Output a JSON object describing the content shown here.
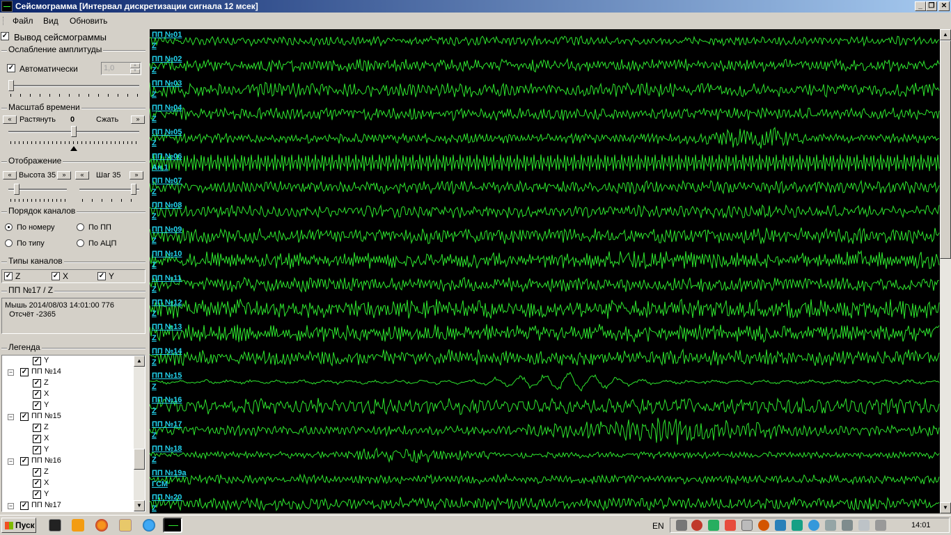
{
  "window": {
    "title": "Сейсмограмма [Интервал дискретизации сигнала 12 мсек]",
    "min_symbol": "_",
    "max_symbol": "❐",
    "close_symbol": "✕"
  },
  "menu": [
    "Файл",
    "Вид",
    "Обновить"
  ],
  "sidebar": {
    "show_seismogram": {
      "label": "Вывод сейсмограммы",
      "checked": true
    },
    "amplitude": {
      "title": "Ослабление амплитуды",
      "auto_label": "Автоматически",
      "auto_checked": true,
      "value": "1,0",
      "slider_level": 0.0
    },
    "time_scale": {
      "title": "Масштаб времени",
      "stretch_label": "Растянуть",
      "value": "0",
      "compress_label": "Сжать",
      "left_btn": "«",
      "right_btn": "»",
      "slider_level": 0.5
    },
    "display": {
      "title": "Отображение",
      "height_label": "Высота 35",
      "step_label": "Шаг 35",
      "left_btn": "«",
      "right_btn": "»",
      "height_level": 0.1,
      "step_level": 0.95
    },
    "channel_order": {
      "title": "Порядок каналов",
      "options": [
        {
          "label": "По номеру",
          "selected": true
        },
        {
          "label": "По ПП",
          "selected": false
        },
        {
          "label": "По типу",
          "selected": false
        },
        {
          "label": "По АЦП",
          "selected": false
        }
      ]
    },
    "channel_types": {
      "title": "Типы каналов",
      "items": [
        {
          "label": "Z",
          "checked": true
        },
        {
          "label": "X",
          "checked": true
        },
        {
          "label": "Y",
          "checked": true
        }
      ]
    },
    "info": {
      "title": "ПП №17 / Z",
      "line1": "Мышь 2014/08/03 14:01:00 776",
      "line2": "  Отсчёт -2365"
    },
    "legend": {
      "title": "Легенда",
      "rows": [
        {
          "level": 2,
          "label": "Y",
          "checked": true
        },
        {
          "level": 1,
          "label": "ПП №14",
          "checked": true,
          "expander": "−"
        },
        {
          "level": 2,
          "label": "Z",
          "checked": true
        },
        {
          "level": 2,
          "label": "X",
          "checked": true
        },
        {
          "level": 2,
          "label": "Y",
          "checked": true
        },
        {
          "level": 1,
          "label": "ПП №15",
          "checked": true,
          "expander": "−"
        },
        {
          "level": 2,
          "label": "Z",
          "checked": true
        },
        {
          "level": 2,
          "label": "X",
          "checked": true
        },
        {
          "level": 2,
          "label": "Y",
          "checked": true
        },
        {
          "level": 1,
          "label": "ПП №16",
          "checked": true,
          "expander": "−"
        },
        {
          "level": 2,
          "label": "Z",
          "checked": true
        },
        {
          "level": 2,
          "label": "X",
          "checked": true
        },
        {
          "level": 2,
          "label": "Y",
          "checked": true
        },
        {
          "level": 1,
          "label": "ПП №17",
          "checked": true,
          "expander": "−"
        }
      ]
    }
  },
  "colors": {
    "trace": "#2ee82e",
    "label": "#22d3ee",
    "background": "#000000"
  },
  "channels": [
    {
      "name": "ПП №01",
      "comp": "Z",
      "amp": 6,
      "freq": 2.3,
      "burst": null
    },
    {
      "name": "ПП №02",
      "comp": "Z",
      "amp": 8,
      "freq": 2.0,
      "burst": null
    },
    {
      "name": "ПП №03",
      "comp": "Z",
      "amp": 9,
      "freq": 2.2,
      "burst": null
    },
    {
      "name": "ПП №04",
      "comp": "Z",
      "amp": 8,
      "freq": 2.1,
      "burst": null
    },
    {
      "name": "ПП №05",
      "comp": "Z",
      "amp": 8,
      "freq": 2.0,
      "burst": "late"
    },
    {
      "name": "ПП №06",
      "comp": "Ан.1",
      "amp": 12,
      "freq": 1.3,
      "burst": "periodic"
    },
    {
      "name": "ПП №07",
      "comp": "Z",
      "amp": 8,
      "freq": 2.2,
      "burst": null
    },
    {
      "name": "ПП №08",
      "comp": "Z",
      "amp": 8,
      "freq": 2.4,
      "burst": null
    },
    {
      "name": "ПП №09",
      "comp": "Z",
      "amp": 10,
      "freq": 2.1,
      "burst": null
    },
    {
      "name": "ПП №10",
      "comp": "Z",
      "amp": 11,
      "freq": 1.6,
      "burst": null
    },
    {
      "name": "ПП №11",
      "comp": "Z",
      "amp": 9,
      "freq": 2.0,
      "burst": null
    },
    {
      "name": "ПП №12",
      "comp": "Z",
      "amp": 12,
      "freq": 1.8,
      "burst": null
    },
    {
      "name": "ПП №13",
      "comp": "Z",
      "amp": 11,
      "freq": 1.7,
      "burst": null
    },
    {
      "name": "ПП №14",
      "comp": "Z",
      "amp": 10,
      "freq": 2.0,
      "burst": null
    },
    {
      "name": "ПП №15",
      "comp": "Z",
      "amp": 4,
      "freq": 1.4,
      "burst": "mid"
    },
    {
      "name": "ПП №16",
      "comp": "Z",
      "amp": 10,
      "freq": 2.6,
      "burst": null
    },
    {
      "name": "ПП №17",
      "comp": "Z",
      "amp": 8,
      "freq": 2.3,
      "burst": "mid2"
    },
    {
      "name": "ПП №18",
      "comp": "Z",
      "amp": 6,
      "freq": 2.0,
      "burst": "early"
    },
    {
      "name": "ПП №19а",
      "comp": "ГСМ",
      "amp": 6,
      "freq": 2.1,
      "burst": null
    },
    {
      "name": "ПП №20",
      "comp": "Z",
      "amp": 8,
      "freq": 2.2,
      "burst": null
    }
  ],
  "taskbar": {
    "start_label": "Пуск",
    "lang": "EN",
    "clock": "14:01"
  }
}
